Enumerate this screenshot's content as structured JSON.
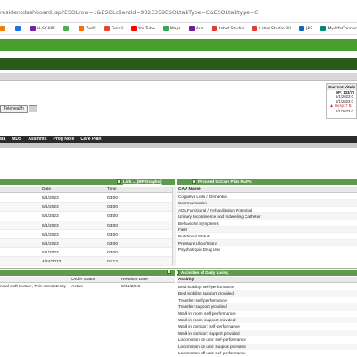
{
  "browser": {
    "url": "residentdashboard.jsp?ESOLrow=1&ESOLclientid=9023358ESOLtabType=C&ESOLtabtype=C"
  },
  "bookmarks": [
    {
      "label": "",
      "color": "#f57c00",
      "icon": "app-icon"
    },
    {
      "label": "",
      "color": "#1a73e8",
      "icon": "app-icon"
    },
    {
      "label": "H-SCAPE",
      "color": "#7b1fa2",
      "icon": "bookmark-icon"
    },
    {
      "label": "",
      "color": "#4caf50",
      "icon": "app-icon"
    },
    {
      "label": "Zwift",
      "color": "#ff6d00",
      "icon": "bookmark-icon"
    },
    {
      "label": "Gmail",
      "color": "#ea4335",
      "icon": "gmail-icon"
    },
    {
      "label": "YouTube",
      "color": "#ff0000",
      "icon": "youtube-icon"
    },
    {
      "label": "Maps",
      "color": "#34a853",
      "icon": "maps-icon"
    },
    {
      "label": "Ara",
      "color": "#6a1b9a",
      "icon": "bookmark-icon"
    },
    {
      "label": "Label Studio",
      "color": "#e53935",
      "icon": "bookmark-icon"
    },
    {
      "label": "Label Studio RV",
      "color": "#e53935",
      "icon": "bookmark-icon"
    },
    {
      "label": "JKS",
      "color": "#1565c0",
      "icon": "bookmark-icon"
    },
    {
      "label": "MyAlfaConnect - Y...",
      "color": "#00897b",
      "icon": "bookmark-icon"
    },
    {
      "label": "Salefo",
      "color": "#00a1e0",
      "icon": "bookmark-icon"
    }
  ],
  "vitals": {
    "title": "Current Vitals",
    "bp_label": "BP: 133/70",
    "bp_date": "5/1/2023 0",
    "date2": "5/1/2023 0",
    "resp_label": "Resp: 7 B",
    "resp_date": "5/1/2023 0"
  },
  "telehealth_label": "Telehealth",
  "tabs": [
    "ata",
    "MDS",
    "Assmnts",
    "Prog Note",
    "Care Plan"
  ],
  "mds_section": {
    "header_link": "Link ... (BP Graphs)",
    "columns": [
      "Date",
      "Time"
    ],
    "rows": [
      {
        "date": "5/1/2023",
        "time": "03:00"
      },
      {
        "date": "5/1/2023",
        "time": "03:00"
      },
      {
        "date": "5/1/2023",
        "time": "03:00"
      },
      {
        "date": "5/1/2023",
        "time": "03:00"
      },
      {
        "date": "5/1/2023",
        "time": "03:00"
      },
      {
        "date": "5/1/2023",
        "time": "03:00"
      },
      {
        "date": "5/1/2023",
        "time": "03:00"
      },
      {
        "date": "4/24/2023",
        "time": "01:12"
      }
    ]
  },
  "caa_section": {
    "header": "Proceed to Care Plan RAPs",
    "column": "CAA Name",
    "items": [
      "Cognitive Loss / Dementia",
      "Communication",
      "ADL Functional / Rehabilitation Potential",
      "Urinary Incontinence and Indwelling Catheter",
      "Behavioral Symptoms",
      "Falls",
      "Nutritional Status",
      "Pressure Ulcer/Injury",
      "Psychotropic Drug Use"
    ]
  },
  "orders": {
    "columns": [
      "Order Status",
      "Revision Date"
    ],
    "rows": [
      {
        "description": "nical Soft texture, Thin consistency",
        "status": "Active",
        "revision": "9/12/2016"
      }
    ]
  },
  "adl_section": {
    "header": "Activities of Daily Living",
    "column": "Activity",
    "items": [
      "Bed mobility: self-performance",
      "Bed mobility: support provided",
      "Transfer: self-performance",
      "Transfer: support provided",
      "Walk in room: self-performance",
      "Walk in room: support provided",
      "Walk in corridor: self-performance",
      "Walk in corridor: support provided",
      "Locomotion on unit: self-performance",
      "Locomotion on unit: support provided",
      "Locomotion off unit: self-performance"
    ]
  }
}
